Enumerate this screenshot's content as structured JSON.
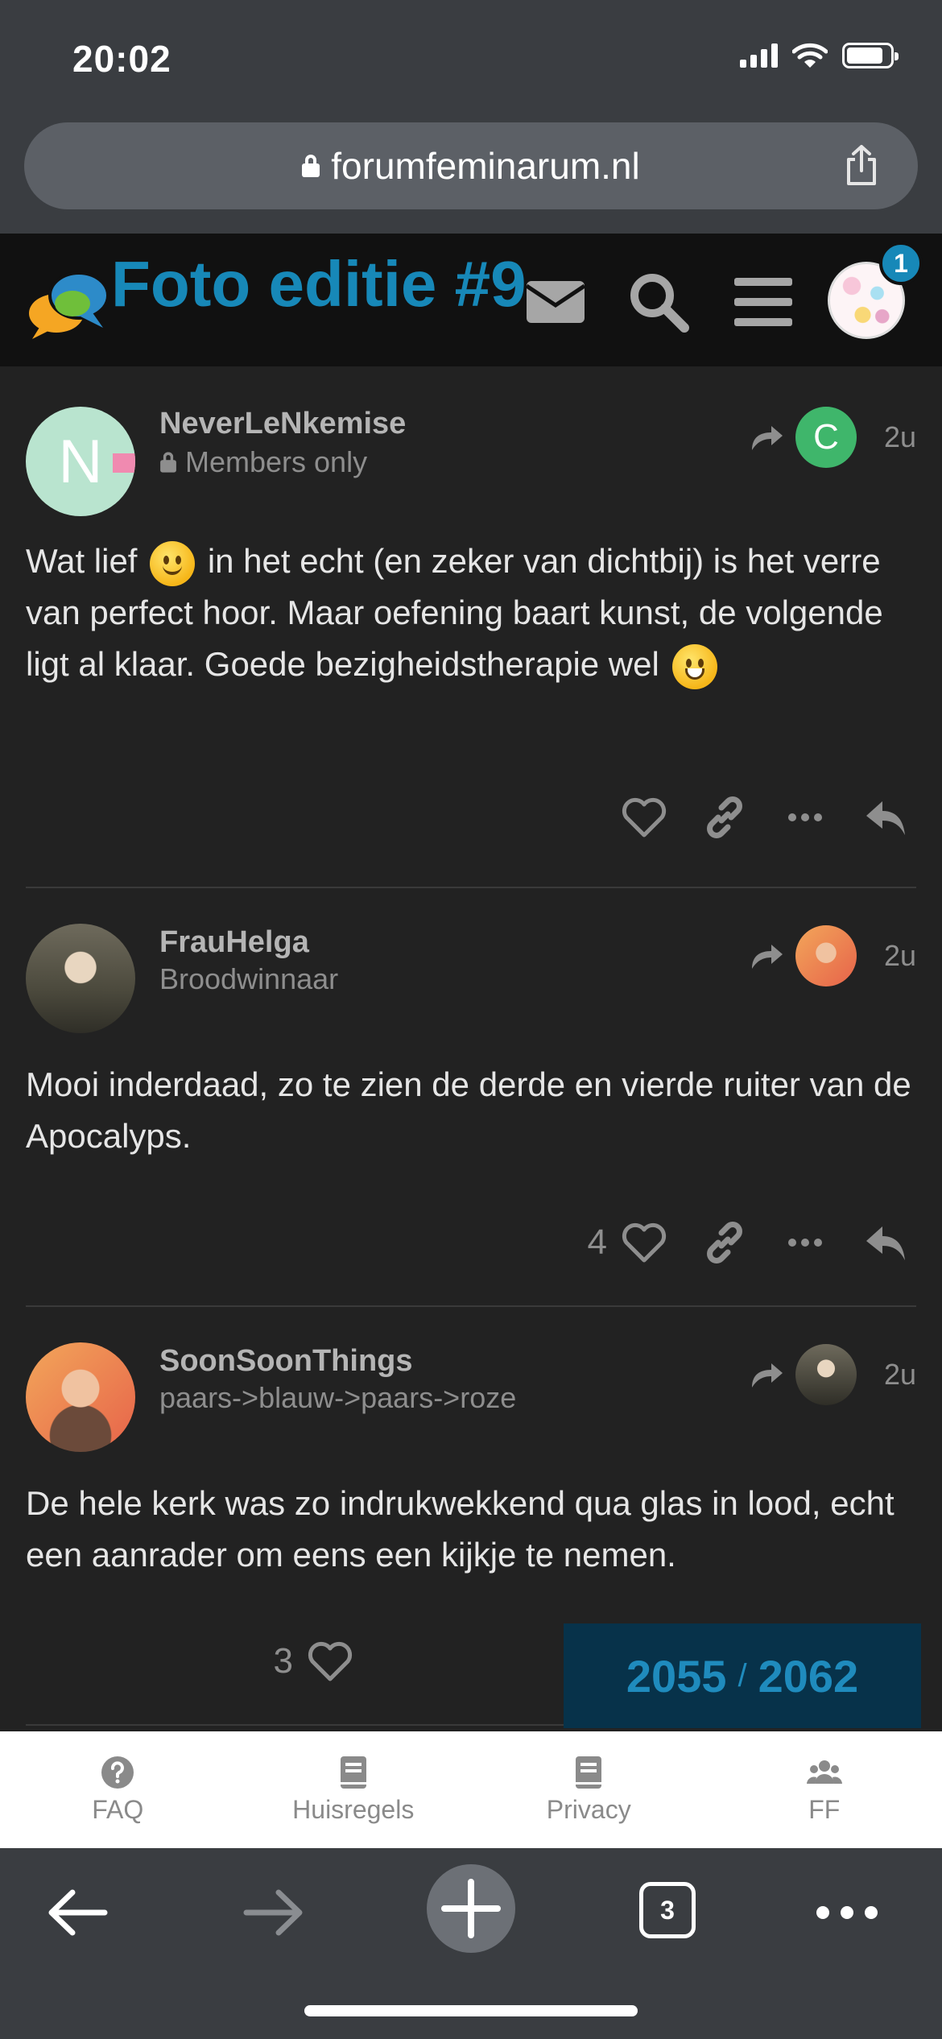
{
  "status_bar": {
    "time": "20:02"
  },
  "browser": {
    "url": "forumfeminarum.nl",
    "tab_count": "3"
  },
  "header": {
    "title": "Foto editie #9",
    "notification_count": "1"
  },
  "posts": [
    {
      "username": "NeverLeNkemise",
      "subtitle": "Members only",
      "avatar_letter": "N",
      "reply_to_letter": "C",
      "time": "2u",
      "body_line1_pre": "Wat lief",
      "body_line1_post": "in het echt (en zeker van dichtbij) is het verre van perfect hoor. Maar oefening baart kunst, de volgende ligt al klaar. Goede bezigheidstherapie wel",
      "likes": ""
    },
    {
      "username": "FrauHelga",
      "subtitle": "Broodwinnaar",
      "time": "2u",
      "body": "Mooi inderdaad, zo te zien de derde en vierde ruiter van de Apocalyps.",
      "likes": "4"
    },
    {
      "username": "SoonSoonThings",
      "subtitle": "paars->blauw->paars->roze",
      "time": "2u",
      "body": "De hele kerk was zo indrukwekkend qua glas in lood, echt een aanrader om eens een kijkje te nemen.",
      "likes": "3"
    }
  ],
  "progress": {
    "current": "2055",
    "separator": "/",
    "total": "2062"
  },
  "footer": {
    "items": [
      {
        "label": "FAQ",
        "icon": "question-circle-icon"
      },
      {
        "label": "Huisregels",
        "icon": "book-icon"
      },
      {
        "label": "Privacy",
        "icon": "book-icon"
      },
      {
        "label": "FF",
        "icon": "users-icon"
      }
    ]
  },
  "colors": {
    "accent": "#1788b8",
    "background": "#222222",
    "header": "#111111",
    "reply_avatar_c": "#3fb66b"
  }
}
